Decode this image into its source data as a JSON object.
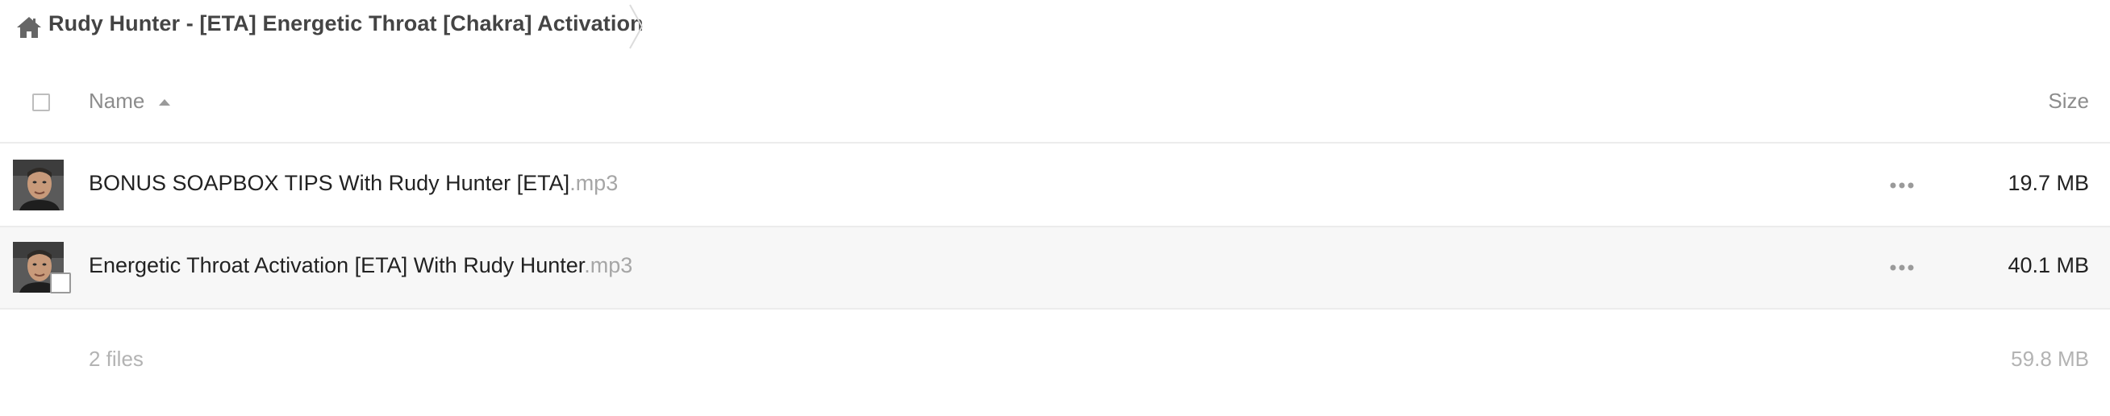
{
  "breadcrumb": {
    "icon": "home-icon",
    "title": "Rudy Hunter - [ETA] Energetic Throat [Chakra] Activation"
  },
  "table": {
    "columns": {
      "name": "Name",
      "size": "Size"
    },
    "sort": {
      "column": "Name",
      "direction": "ascending"
    },
    "files": [
      {
        "name": "BONUS SOAPBOX TIPS With Rudy Hunter [ETA]",
        "ext": ".mp3",
        "size": "19.7 MB"
      },
      {
        "name": "Energetic Throat Activation [ETA] With Rudy Hunter",
        "ext": ".mp3",
        "size": "40.1 MB"
      }
    ]
  },
  "summary": {
    "count": "2 files",
    "total_size": "59.8 MB"
  },
  "colors": {
    "title_text": "#444444",
    "muted_text": "#8c8c8c",
    "extension_text": "#a6a6a6",
    "summary_text": "#b3b3b3",
    "row_hover_bg": "#f7f7f7",
    "divider": "#ececec"
  }
}
